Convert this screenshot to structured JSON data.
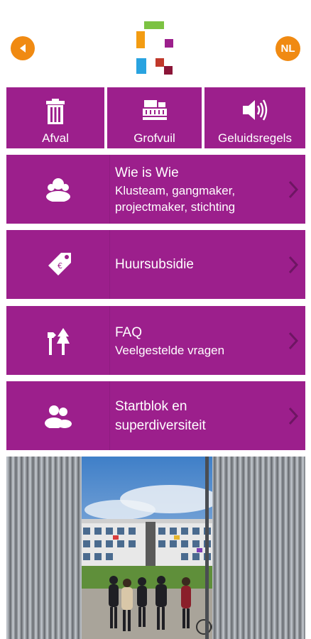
{
  "header": {
    "back_icon": "back-arrow-icon",
    "language_label": "NL",
    "accent_color": "#f08a12"
  },
  "tiles": [
    {
      "label": "Afval",
      "icon": "trash-bin-icon"
    },
    {
      "label": "Grofvuil",
      "icon": "bulky-waste-icon"
    },
    {
      "label": "Geluidsregels",
      "icon": "speaker-icon"
    }
  ],
  "menu": [
    {
      "title": "Wie is Wie",
      "subtitle": "Klusteam, gangmaker, projectmaker, stichting",
      "icon": "people-icon"
    },
    {
      "title": "Huursubsidie",
      "subtitle": "",
      "icon": "price-tag-icon"
    },
    {
      "title": "FAQ",
      "subtitle": "Veelgestelde vragen",
      "icon": "signpost-tree-icon"
    },
    {
      "title": "Startblok en superdiversiteit",
      "subtitle": "",
      "icon": "group-icon"
    }
  ],
  "brand_color": "#9c1f8c",
  "photo": {
    "icon": "building-photo"
  }
}
